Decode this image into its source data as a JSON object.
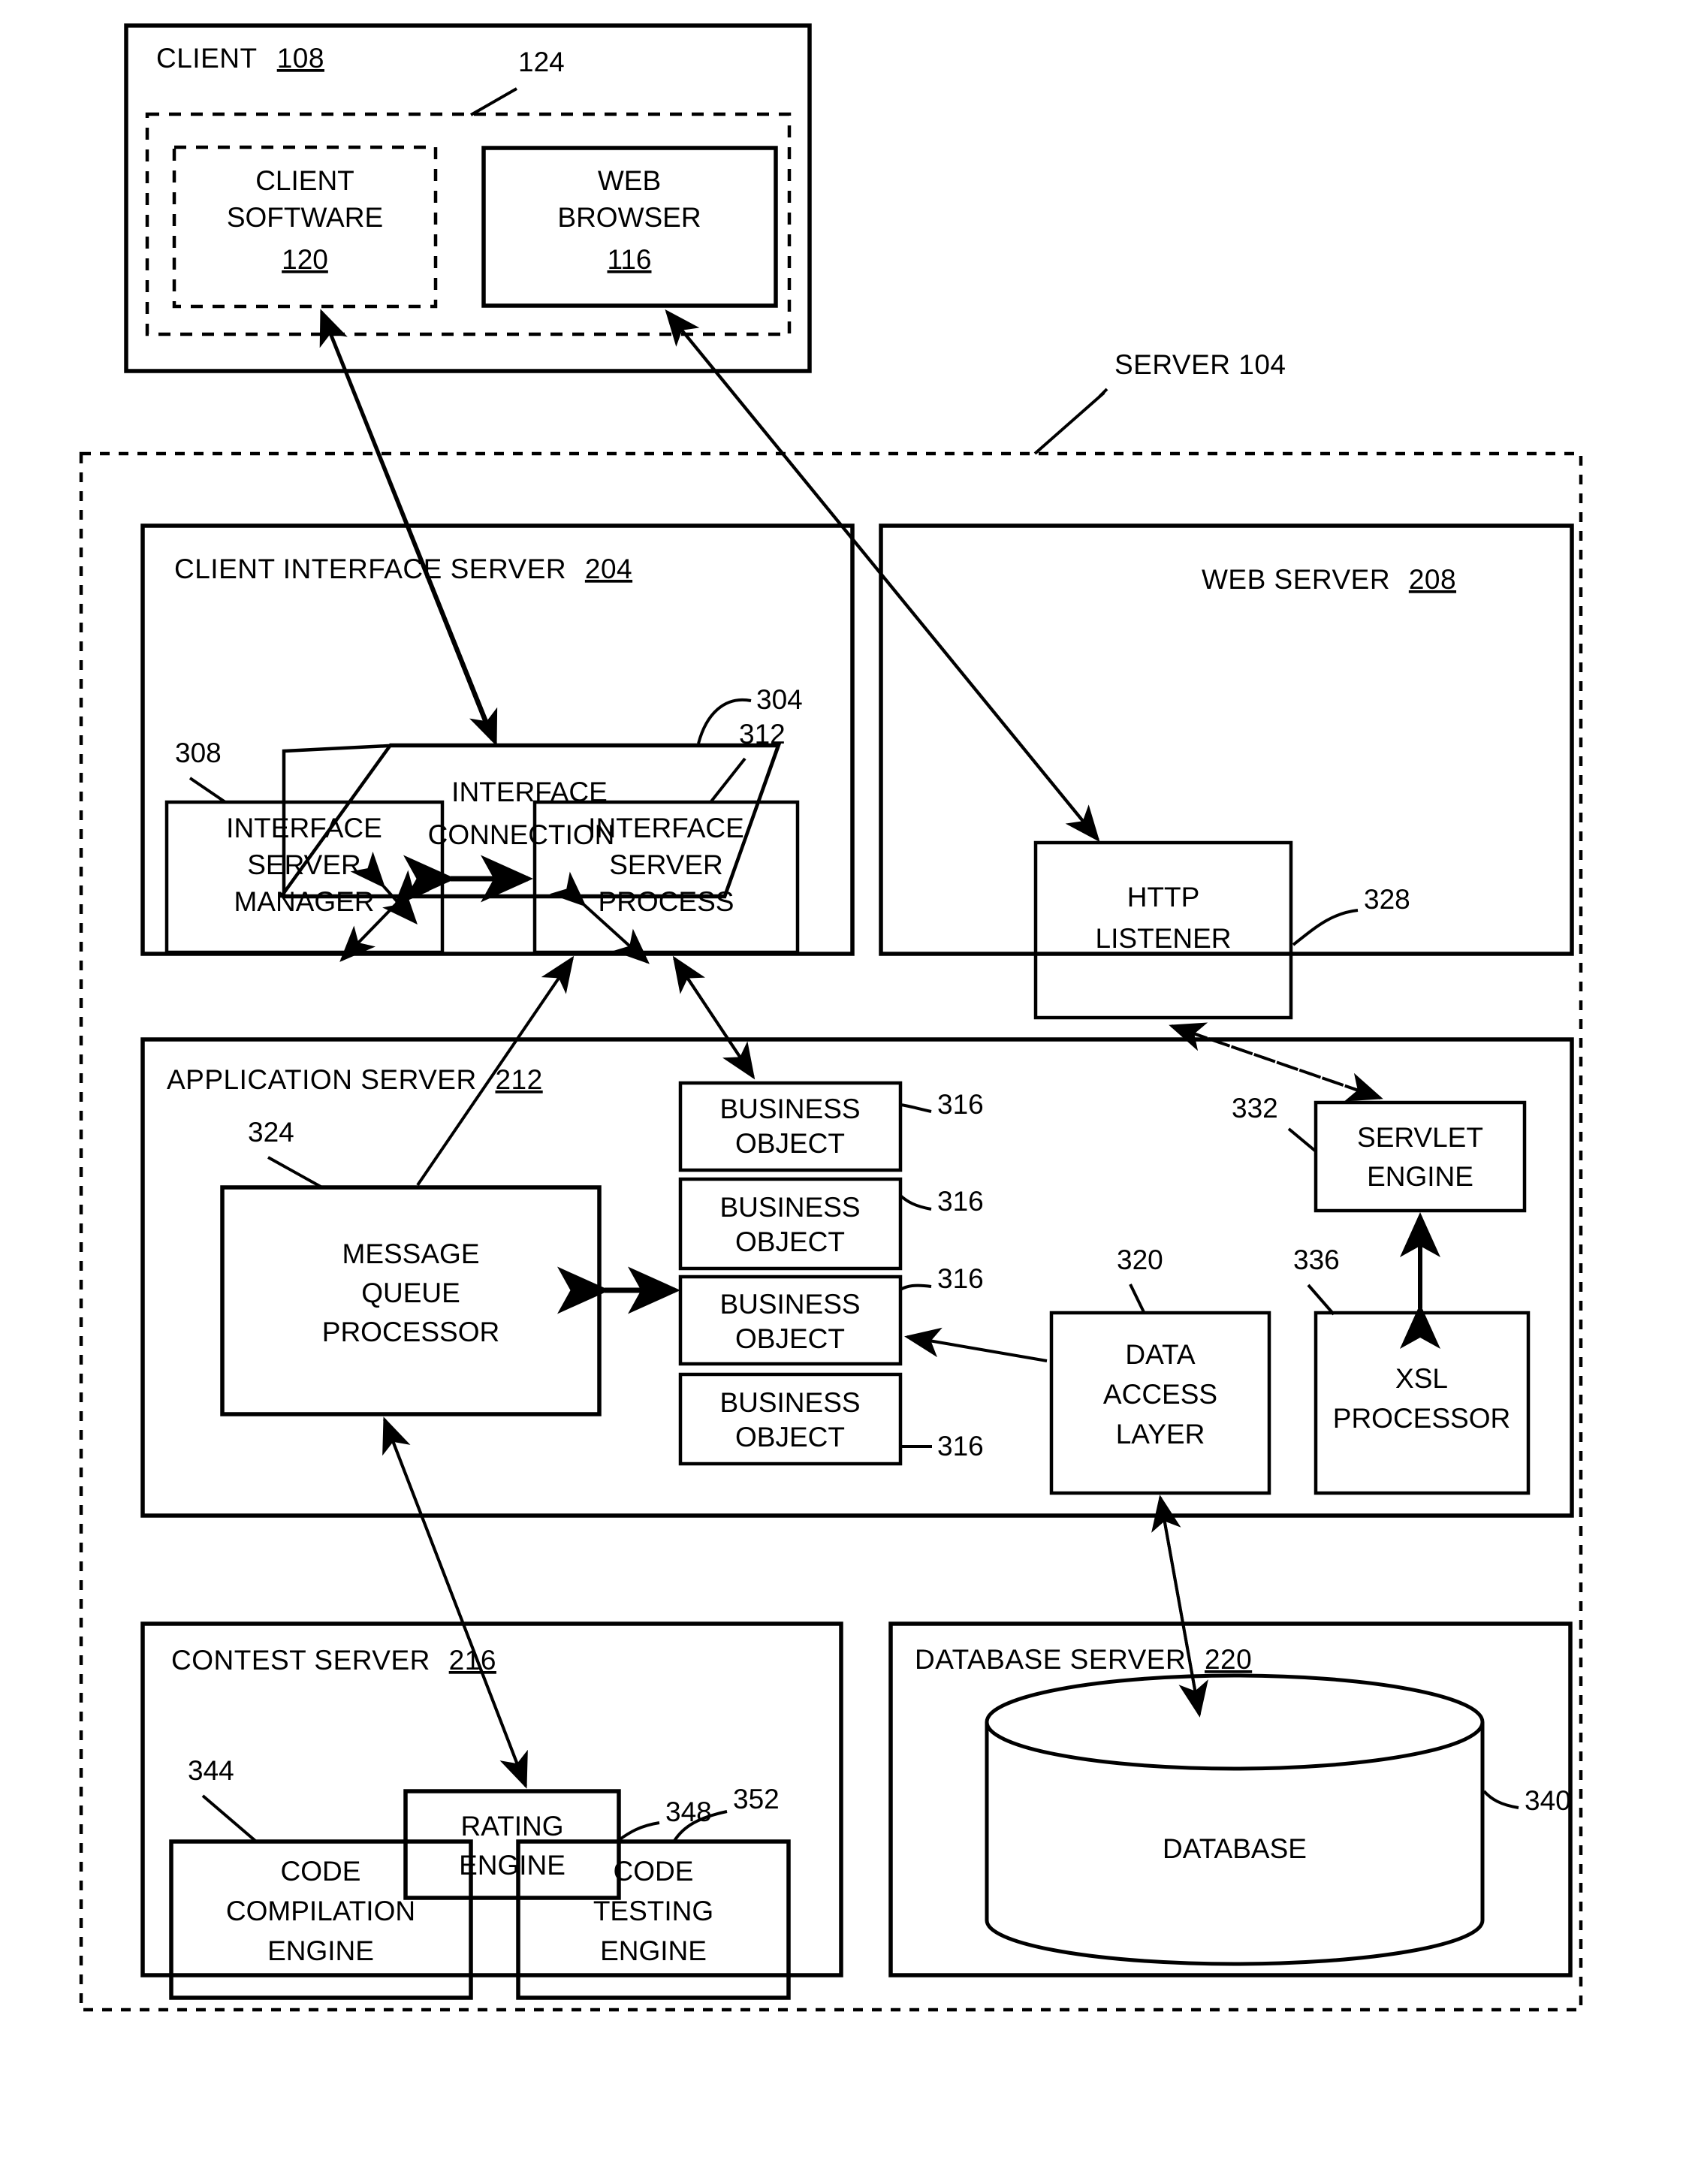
{
  "figure": {
    "type": "patent-architecture-diagram",
    "background": "#ffffff",
    "line_color": "#000000"
  },
  "client": {
    "title": "CLIENT",
    "ref": "108",
    "group_ref": "124",
    "software": {
      "line1": "CLIENT",
      "line2": "SOFTWARE",
      "ref": "120"
    },
    "browser": {
      "line1": "WEB",
      "line2": "BROWSER",
      "ref": "116"
    }
  },
  "server": {
    "title": "SERVER 104",
    "client_interface_server": {
      "title": "CLIENT INTERFACE SERVER",
      "ref": "204",
      "interface_connection": {
        "line1": "INTERFACE",
        "line2": "CONNECTION",
        "ref": "304"
      },
      "interface_server_manager": {
        "line1": "INTERFACE",
        "line2": "SERVER",
        "line3": "MANAGER",
        "ref": "308"
      },
      "interface_server_process": {
        "line1": "INTERFACE",
        "line2": "SERVER",
        "line3": "PROCESS",
        "ref": "312"
      }
    },
    "web_server": {
      "title": "WEB SERVER",
      "ref": "208",
      "http_listener": {
        "line1": "HTTP",
        "line2": "LISTENER",
        "ref": "328"
      }
    },
    "application_server": {
      "title": "APPLICATION SERVER",
      "ref": "212",
      "message_queue_processor": {
        "line1": "MESSAGE",
        "line2": "QUEUE",
        "line3": "PROCESSOR",
        "ref": "324"
      },
      "business_objects": [
        {
          "line1": "BUSINESS",
          "line2": "OBJECT",
          "ref": "316"
        },
        {
          "line1": "BUSINESS",
          "line2": "OBJECT",
          "ref": "316"
        },
        {
          "line1": "BUSINESS",
          "line2": "OBJECT",
          "ref": "316"
        },
        {
          "line1": "BUSINESS",
          "line2": "OBJECT",
          "ref": "316"
        }
      ],
      "data_access_layer": {
        "line1": "DATA",
        "line2": "ACCESS",
        "line3": "LAYER",
        "ref": "320"
      },
      "servlet_engine": {
        "line1": "SERVLET",
        "line2": "ENGINE",
        "ref": "332"
      },
      "xsl_processor": {
        "line1": "XSL",
        "line2": "PROCESSOR",
        "ref": "336"
      }
    },
    "contest_server": {
      "title": "CONTEST SERVER",
      "ref": "216",
      "rating_engine": {
        "line1": "RATING",
        "line2": "ENGINE",
        "ref": "348"
      },
      "code_compilation_engine": {
        "line1": "CODE",
        "line2": "COMPILATION",
        "line3": "ENGINE",
        "ref": "344"
      },
      "code_testing_engine": {
        "line1": "CODE",
        "line2": "TESTING",
        "line3": "ENGINE",
        "ref": "352"
      }
    },
    "database_server": {
      "title": "DATABASE SERVER",
      "ref": "220",
      "database": {
        "label": "DATABASE",
        "ref": "340"
      }
    }
  }
}
